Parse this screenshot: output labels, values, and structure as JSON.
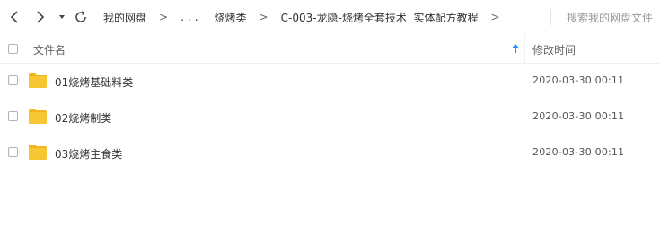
{
  "toolbar": {
    "back_icon": "chevron-left-icon",
    "forward_icon": "chevron-right-icon",
    "history_icon": "caret-down-icon",
    "refresh_icon": "refresh-icon"
  },
  "breadcrumb": {
    "items": [
      "我的网盘",
      "...",
      "烧烤类",
      "C-003-龙隐-烧烤全套技术  实体配方教程"
    ],
    "separator": ">"
  },
  "search": {
    "placeholder": "搜索我的网盘文件"
  },
  "table": {
    "headers": {
      "name": "文件名",
      "modified": "修改时间"
    },
    "sort_icon": "arrow-up-icon",
    "sort_color": "#1e90ff",
    "rows": [
      {
        "name": "01烧烤基础料类",
        "modified": "2020-03-30 00:11",
        "icon": "folder-icon"
      },
      {
        "name": "02烧烤制类",
        "modified": "2020-03-30 00:11",
        "icon": "folder-icon"
      },
      {
        "name": "03烧烤主食类",
        "modified": "2020-03-30 00:11",
        "icon": "folder-icon"
      }
    ]
  },
  "colors": {
    "folder": "#f7c633",
    "folder_tab": "#f0b51f"
  }
}
